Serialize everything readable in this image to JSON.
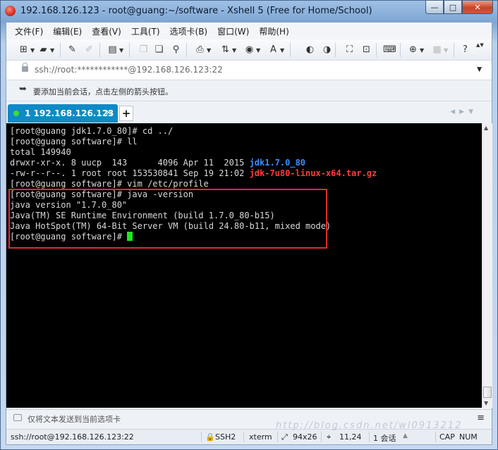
{
  "window": {
    "title": "192.168.126.123 - root@guang:~/software - Xshell 5 (Free for Home/School)",
    "controls": {
      "minimize": "—",
      "maximize": "□",
      "close": "✕"
    }
  },
  "menu": [
    "文件(F)",
    "编辑(E)",
    "查看(V)",
    "工具(T)",
    "选项卡(B)",
    "窗口(W)",
    "帮助(H)"
  ],
  "address": {
    "value": "ssh://root:************@192.168.126.123:22"
  },
  "infobar": {
    "text": "要添加当前会话，点击左侧的箭头按钮。"
  },
  "tabs": [
    {
      "label": "1 192.168.126.123",
      "status_color": "#3ddc3d",
      "active_color": "#0f8ac6"
    }
  ],
  "terminal": {
    "lines": [
      [
        {
          "t": "[root@guang jdk1.7.0_80]# cd ../"
        }
      ],
      [
        {
          "t": "[root@guang software]# ll"
        }
      ],
      [
        {
          "t": "total 149940"
        }
      ],
      [
        {
          "t": "drwxr-xr-x. 8 uucp  143      4096 Apr 11  2015 "
        },
        {
          "t": "jdk1.7.0_80",
          "c": "blue"
        }
      ],
      [
        {
          "t": "-rw-r--r--. 1 root root 153530841 Sep 19 21:02 "
        },
        {
          "t": "jdk-7u80-linux-x64.tar.gz",
          "c": "red"
        }
      ],
      [
        {
          "t": "[root@guang software]# vim /etc/profile"
        }
      ],
      [
        {
          "t": "[root@guang software]# java -version"
        }
      ],
      [
        {
          "t": "java version \"1.7.0_80\""
        }
      ],
      [
        {
          "t": "Java(TM) SE Runtime Environment (build 1.7.0_80-b15)"
        }
      ],
      [
        {
          "t": "Java HotSpot(TM) 64-Bit Server VM (build 24.80-b11, mixed mode)"
        }
      ],
      [
        {
          "t": "[root@guang software]# "
        },
        {
          "cursor": true
        }
      ]
    ],
    "colors": {
      "background": "#000000",
      "text": "#d8d8d8",
      "directory": "#3a8fff",
      "archive": "#ff3b3b",
      "cursor": "#1ee81e",
      "highlight_box": "#e52a2a"
    }
  },
  "compose": {
    "placeholder": "仅将文本发送到当前选项卡"
  },
  "status": {
    "connection": "ssh://root@192.168.126.123:22",
    "protocol": "SSH2",
    "terminal_type": "xterm",
    "size": "94x26",
    "position": "11,24",
    "sessions": "1 会话",
    "caps": "CAP",
    "num": "NUM"
  },
  "watermark": "http://blog.csdn.net/wl0913212"
}
